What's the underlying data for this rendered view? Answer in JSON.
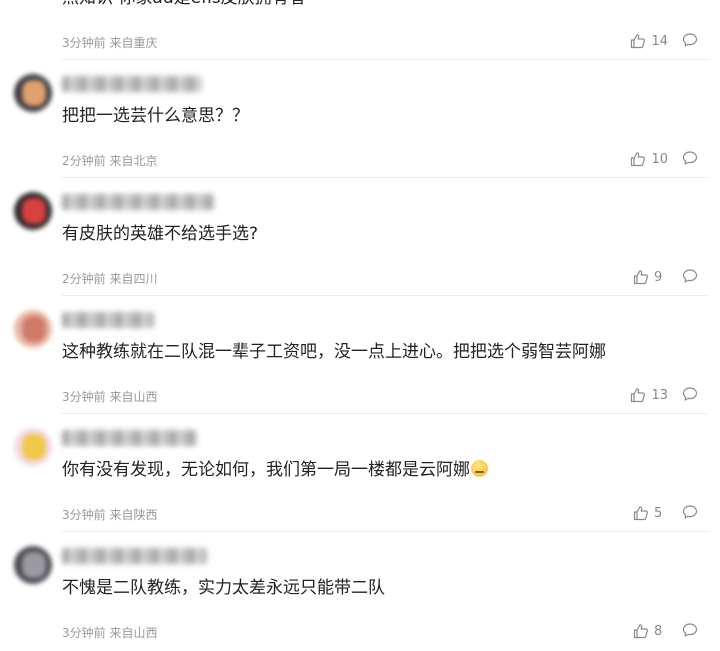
{
  "comments": [
    {
      "text": "热知识 你家ad是efls皮肤拥有者",
      "time": "3分钟前",
      "location": "来自重庆",
      "likes": "14",
      "avatar_colors": [
        "#e9d7c8",
        "#b98e7a"
      ]
    },
    {
      "text": "把把一选芸什么意思？？",
      "time": "2分钟前",
      "location": "来自北京",
      "likes": "10",
      "avatar_colors": [
        "#3a3a42",
        "#e0a070"
      ]
    },
    {
      "text": "有皮肤的英雄不给选手选?",
      "time": "2分钟前",
      "location": "来自四川",
      "likes": "9",
      "avatar_colors": [
        "#2c2c2c",
        "#d94040"
      ]
    },
    {
      "text": "这种教练就在二队混一辈子工资吧，没一点上进心。把把选个弱智芸阿娜",
      "time": "3分钟前",
      "location": "来自山西",
      "likes": "13",
      "avatar_colors": [
        "#e8b9a6",
        "#d07a6a"
      ]
    },
    {
      "text": "你有没有发现，无论如何，我们第一局一楼都是云阿娜",
      "time": "3分钟前",
      "location": "来自陕西",
      "likes": "5",
      "avatar_colors": [
        "#f2d9e4",
        "#f0c84a"
      ],
      "emoji": "sleepy-face-emoji"
    },
    {
      "text": "不愧是二队教练，实力太差永远只能带二队",
      "time": "3分钟前",
      "location": "来自山西",
      "likes": "8",
      "avatar_colors": [
        "#4a4a52",
        "#9a9aa0"
      ]
    }
  ]
}
